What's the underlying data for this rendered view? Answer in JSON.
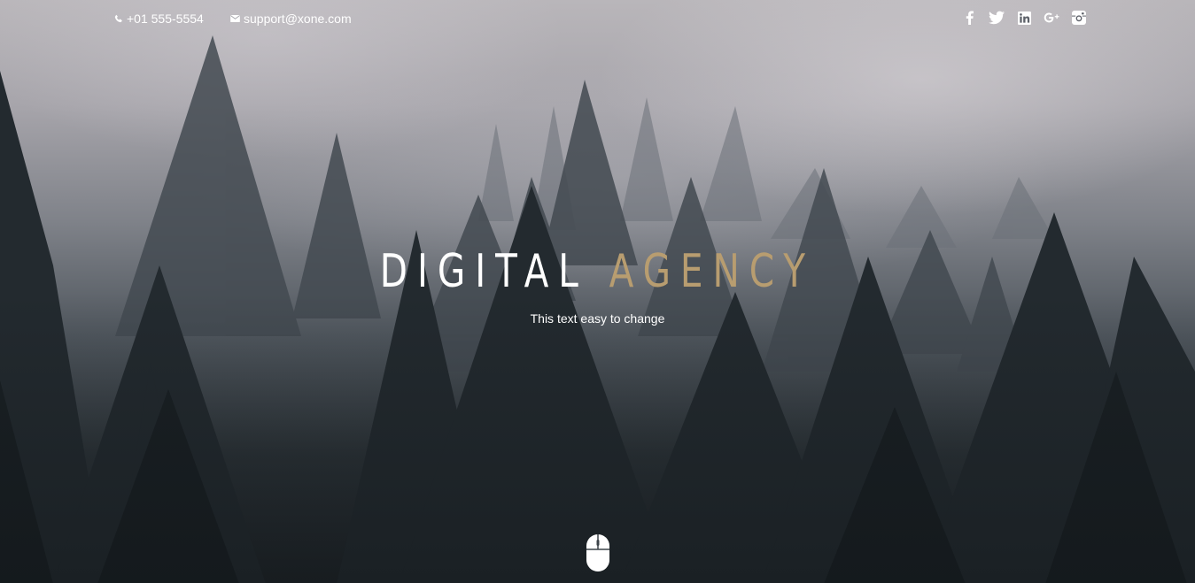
{
  "topbar": {
    "phone": {
      "icon": "phone-icon",
      "text": "+01 555-5554"
    },
    "email": {
      "icon": "envelope-icon",
      "text": "support@xone.com"
    },
    "social": [
      {
        "name": "facebook-icon"
      },
      {
        "name": "twitter-icon"
      },
      {
        "name": "linkedin-icon"
      },
      {
        "name": "google-plus-icon"
      },
      {
        "name": "instagram-icon"
      }
    ]
  },
  "hero": {
    "title_word1": "DIGITAL",
    "title_word2": "AGENCY",
    "subtitle": "This text easy to change",
    "scroll_icon": "mouse-scroll-icon"
  },
  "colors": {
    "accent": "#b89d70",
    "text": "#ffffff"
  }
}
